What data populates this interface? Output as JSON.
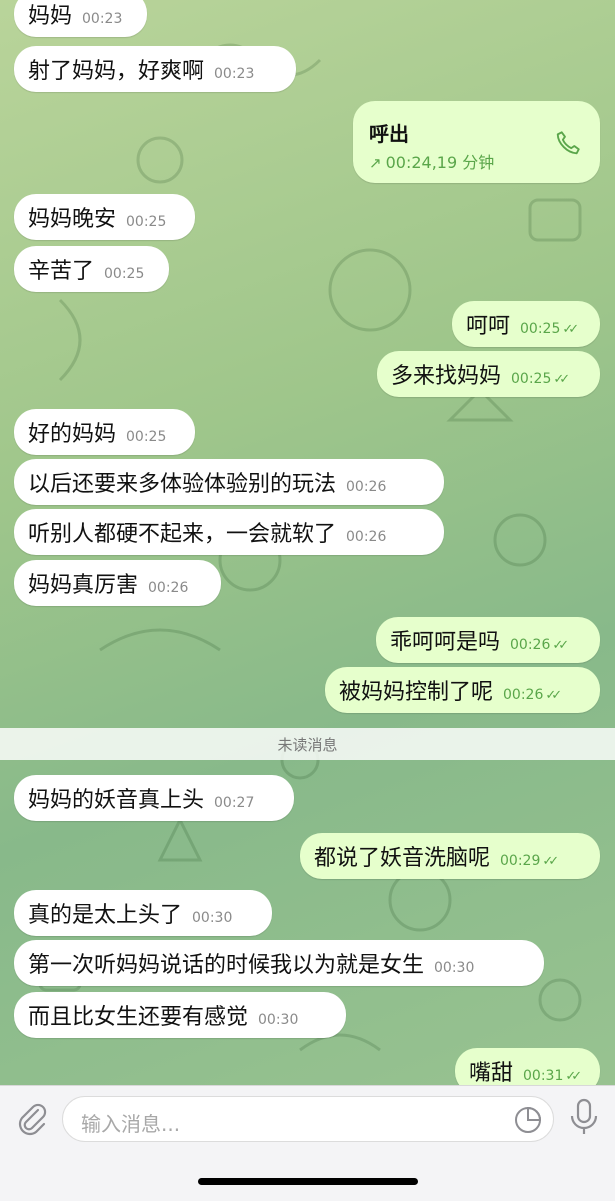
{
  "messages": [
    {
      "text": "妈妈",
      "time": "00:23"
    },
    {
      "text": "射了妈妈，好爽啊",
      "time": "00:23"
    },
    {
      "text": "妈妈晚安",
      "time": "00:25"
    },
    {
      "text": "辛苦了",
      "time": "00:25"
    },
    {
      "text": "呵呵",
      "time": "00:25"
    },
    {
      "text": "多来找妈妈",
      "time": "00:25"
    },
    {
      "text": "好的妈妈",
      "time": "00:25"
    },
    {
      "text": "以后还要来多体验体验别的玩法",
      "time": "00:26"
    },
    {
      "text": "听别人都硬不起来，一会就软了",
      "time": "00:26"
    },
    {
      "text": "妈妈真厉害",
      "time": "00:26"
    },
    {
      "text": "乖呵呵是吗",
      "time": "00:26"
    },
    {
      "text": "被妈妈控制了呢",
      "time": "00:26"
    },
    {
      "text": "妈妈的妖音真上头",
      "time": "00:27"
    },
    {
      "text": "都说了妖音洗脑呢",
      "time": "00:29"
    },
    {
      "text": "真的是太上头了",
      "time": "00:30"
    },
    {
      "text": "第一次听妈妈说话的时候我以为就是女生",
      "time": "00:30"
    },
    {
      "text": "而且比女生还要有感觉",
      "time": "00:30"
    },
    {
      "text": "嘴甜",
      "time": "00:31"
    }
  ],
  "call": {
    "title": "呼出",
    "arrow": "↗",
    "detail": "00:24,19 分钟",
    "icon": "phone-icon"
  },
  "divider": {
    "label": "未读消息"
  },
  "composer": {
    "placeholder": "输入消息..."
  },
  "colors": {
    "incoming": "#ffffff",
    "outgoing": "#e6ffcc",
    "accent": "#5aa64a"
  }
}
